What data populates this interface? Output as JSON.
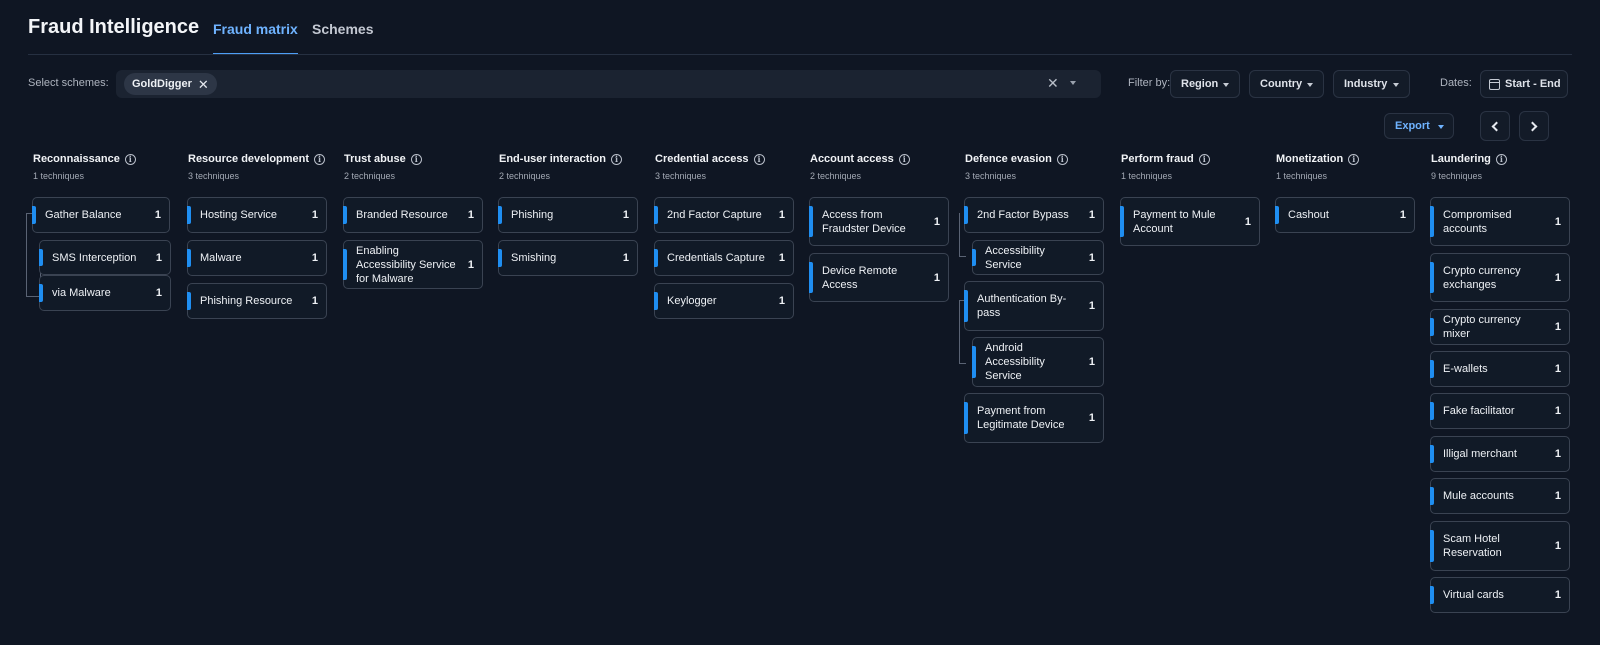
{
  "app": {
    "title": "Fraud Intelligence",
    "tabs": [
      {
        "label": "Fraud matrix",
        "active": true
      },
      {
        "label": "Schemes",
        "active": false
      }
    ]
  },
  "filters": {
    "select_label": "Select schemes:",
    "selected_scheme": "GoldDigger",
    "filter_by_label": "Filter by:",
    "dropdowns": [
      "Region",
      "Country",
      "Industry"
    ],
    "dates_label": "Dates:",
    "date_range": "Start - End"
  },
  "toolbar": {
    "export_label": "Export"
  },
  "colors": {
    "background": "#0f1623",
    "accent": "#1f8ef1",
    "active_tab": "#6fb3ff"
  },
  "columns": [
    {
      "title": "Reconnaissance",
      "count": "1 techniques",
      "cards": [
        {
          "label": "Gather Balance",
          "count": "1"
        },
        {
          "label": "SMS Interception",
          "count": "1"
        },
        {
          "label": "via Malware",
          "count": "1"
        }
      ]
    },
    {
      "title": "Resource development",
      "count": "3 techniques",
      "cards": [
        {
          "label": "Hosting Service",
          "count": "1"
        },
        {
          "label": "Malware",
          "count": "1"
        },
        {
          "label": "Phishing Resource",
          "count": "1"
        }
      ]
    },
    {
      "title": "Trust abuse",
      "count": "2 techniques",
      "cards": [
        {
          "label": "Branded Resource",
          "count": "1"
        },
        {
          "label": "Enabling Accessibility Service for Malware",
          "count": "1"
        }
      ]
    },
    {
      "title": "End-user interaction",
      "count": "2 techniques",
      "cards": [
        {
          "label": "Phishing",
          "count": "1"
        },
        {
          "label": "Smishing",
          "count": "1"
        }
      ]
    },
    {
      "title": "Credential access",
      "count": "3 techniques",
      "cards": [
        {
          "label": "2nd Factor Capture",
          "count": "1"
        },
        {
          "label": "Credentials Capture",
          "count": "1"
        },
        {
          "label": "Keylogger",
          "count": "1"
        }
      ]
    },
    {
      "title": "Account access",
      "count": "2 techniques",
      "cards": [
        {
          "label": "Access from Fraudster Device",
          "count": "1"
        },
        {
          "label": "Device Remote Access",
          "count": "1"
        }
      ]
    },
    {
      "title": "Defence evasion",
      "count": "3 techniques",
      "cards": [
        {
          "label": "2nd Factor Bypass",
          "count": "1"
        },
        {
          "label": "Accessibility Service",
          "count": "1"
        },
        {
          "label": "Authentication By-pass",
          "count": "1"
        },
        {
          "label": "Android Accessibility Service",
          "count": "1"
        },
        {
          "label": "Payment from Legitimate Device",
          "count": "1"
        }
      ]
    },
    {
      "title": "Perform fraud",
      "count": "1 techniques",
      "cards": [
        {
          "label": "Payment to Mule Account",
          "count": "1"
        }
      ]
    },
    {
      "title": "Monetization",
      "count": "1 techniques",
      "cards": [
        {
          "label": "Cashout",
          "count": "1"
        }
      ]
    },
    {
      "title": "Laundering",
      "count": "9 techniques",
      "cards": [
        {
          "label": "Compromised accounts",
          "count": "1"
        },
        {
          "label": "Crypto currency exchanges",
          "count": "1"
        },
        {
          "label": "Crypto currency mixer",
          "count": "1"
        },
        {
          "label": "E-wallets",
          "count": "1"
        },
        {
          "label": "Fake facilitator",
          "count": "1"
        },
        {
          "label": "Illigal merchant",
          "count": "1"
        },
        {
          "label": "Mule accounts",
          "count": "1"
        },
        {
          "label": "Scam Hotel Reservation",
          "count": "1"
        },
        {
          "label": "Virtual cards",
          "count": "1"
        }
      ]
    }
  ]
}
